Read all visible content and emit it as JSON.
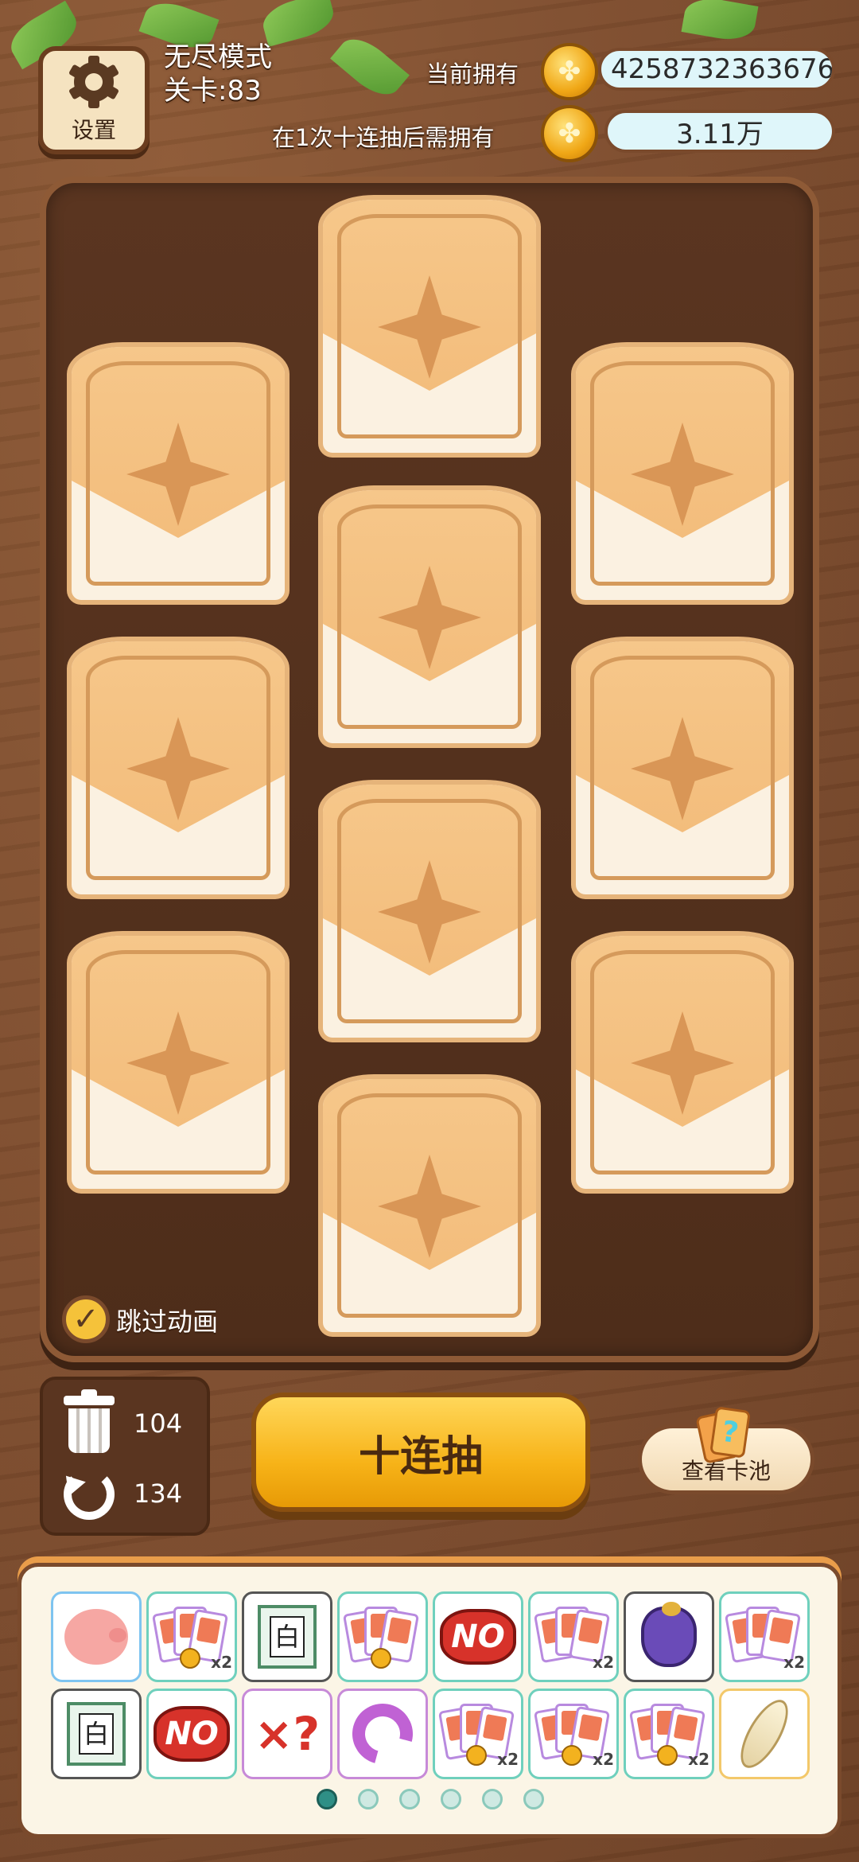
{
  "header": {
    "settings_label": "设置",
    "mode_title": "无尽模式",
    "level_text": "关卡:83",
    "owned_label": "当前拥有",
    "owned_value": "4258732363676",
    "need_label": "在1次十连抽后需拥有",
    "need_value": "3.11万",
    "coin_icon": "coin-icon",
    "clover_icon": "clover-coin-icon"
  },
  "board": {
    "card_count": 10,
    "skip_label": "跳过动画",
    "skip_checked": true
  },
  "tools": {
    "trash_count": "104",
    "undo_count": "134"
  },
  "actions": {
    "draw_ten_label": "十连抽",
    "view_pool_label": "查看卡池"
  },
  "inventory": {
    "items": [
      {
        "icon": "piggy-bank-icon",
        "label": ""
      },
      {
        "icon": "card-pack-coin-x2-icon",
        "label": "x2"
      },
      {
        "icon": "mahjong-white-tile-icon",
        "label": "白"
      },
      {
        "icon": "card-pack-coin-plus-icon",
        "label": ""
      },
      {
        "icon": "no-stamp-icon",
        "label": "NO"
      },
      {
        "icon": "card-pack-x2-icon",
        "label": "x2"
      },
      {
        "icon": "lucky-bag-icon",
        "label": ""
      },
      {
        "icon": "card-pack-x2-icon",
        "label": "x2"
      },
      {
        "icon": "mahjong-white-tile-icon",
        "label": "白"
      },
      {
        "icon": "no-stamp-icon",
        "label": "NO"
      },
      {
        "icon": "cross-question-icon",
        "label": "×?"
      },
      {
        "icon": "undo-arrow-icon",
        "label": ""
      },
      {
        "icon": "card-pack-coin-x2-icon",
        "label": "x2"
      },
      {
        "icon": "card-pack-coin-x2-icon",
        "label": "x2"
      },
      {
        "icon": "card-pack-coin-x2-icon",
        "label": "x2"
      },
      {
        "icon": "feather-charm-icon",
        "label": ""
      }
    ],
    "page_count": 6,
    "active_page": 1
  },
  "colors": {
    "wood": "#7a4a2c",
    "card_orange": "#f3bd7c",
    "button_gold": "#f7b318",
    "teal_border": "#6fd0bd"
  }
}
